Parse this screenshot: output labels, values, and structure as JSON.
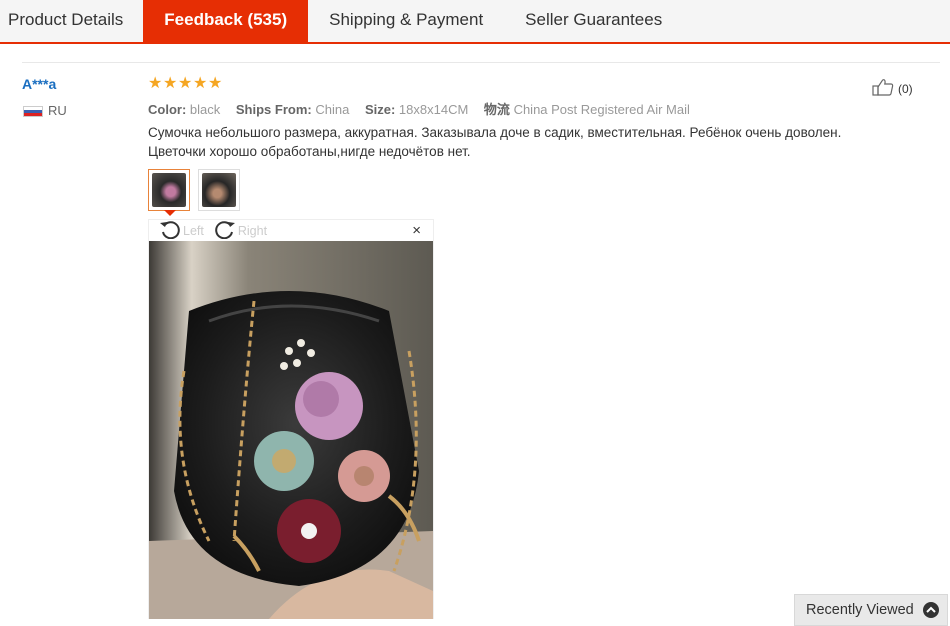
{
  "tabs": [
    {
      "label": "Product Details"
    },
    {
      "label": "Feedback (535)"
    },
    {
      "label": "Shipping & Payment"
    },
    {
      "label": "Seller Guarantees"
    }
  ],
  "review": {
    "user": "A***a",
    "country": "RU",
    "rating": 5,
    "color_label": "Color:",
    "color_value": "black",
    "ships_label": "Ships From:",
    "ships_value": "China",
    "size_label": "Size:",
    "size_value": "18x8x14CM",
    "logistics_label": "物流",
    "logistics_value": "China Post Registered Air Mail",
    "text_line1": "Сумочка небольшого размера, аккуратная. Заказывала доче в садик, вместительная. Ребёнок очень доволен.",
    "text_line2": "Цветочки хорошо обработаны,нигде недочётов нет.",
    "helpful_count": "(0)"
  },
  "viewer": {
    "rotate_left": "Left",
    "rotate_right": "Right",
    "close": "×"
  },
  "recently_viewed": "Recently Viewed",
  "colors": {
    "accent": "#e62e04",
    "star": "#f5a623",
    "link": "#1a6ec0"
  }
}
